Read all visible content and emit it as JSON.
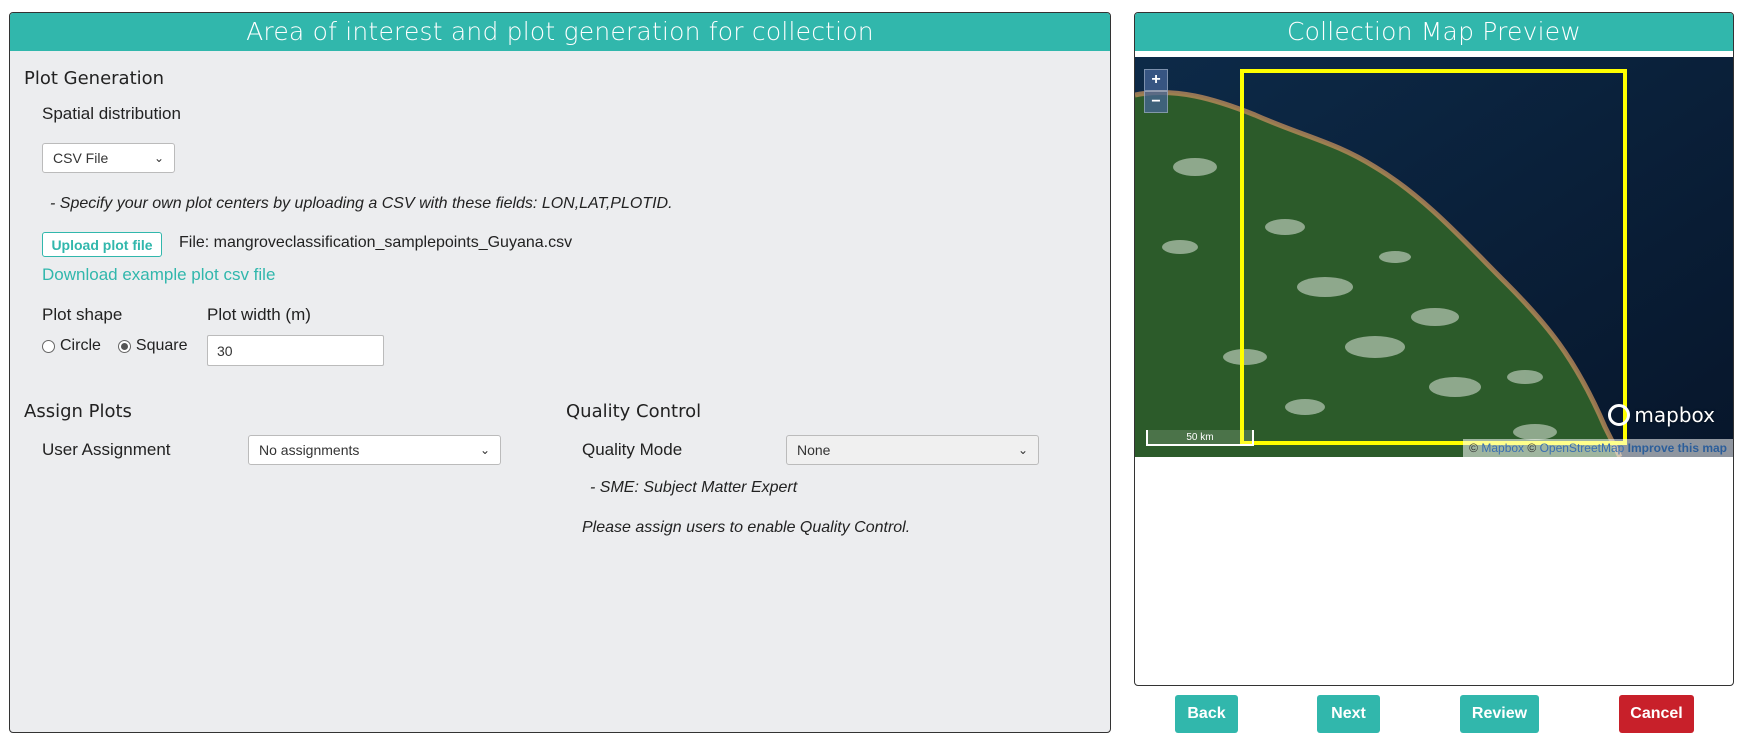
{
  "left_panel": {
    "title": "Area of interest and plot generation for collection",
    "plot_generation": {
      "heading": "Plot Generation",
      "spatial_label": "Spatial distribution",
      "spatial_value": "CSV File",
      "hint": "- Specify your own plot centers by uploading a CSV with these fields: LON,LAT,PLOTID.",
      "upload_label": "Upload plot file",
      "file_text": "File: mangroveclassification_samplepoints_Guyana.csv",
      "download_link": "Download example plot csv file",
      "shape_label": "Plot shape",
      "shape_options": [
        "Circle",
        "Square"
      ],
      "shape_selected": "Square",
      "width_label": "Plot width (m)",
      "width_value": "30"
    },
    "assign": {
      "heading": "Assign Plots",
      "user_label": "User Assignment",
      "user_value": "No assignments"
    },
    "quality": {
      "heading": "Quality Control",
      "mode_label": "Quality Mode",
      "mode_value": "None",
      "sme_note": "- SME: Subject Matter Expert",
      "enable_note": "Please assign users to enable Quality Control."
    }
  },
  "right_panel": {
    "title": "Collection Map Preview",
    "map": {
      "zoom_in": "+",
      "zoom_out": "−",
      "scale_label": "50 km",
      "logo_text": "mapbox",
      "attrib_copy1": "©",
      "attrib_mapbox": "Mapbox",
      "attrib_copy2": "©",
      "attrib_osm": "OpenStreetMap",
      "attrib_improve": "Improve this map",
      "bounds_color": "#ffff00"
    }
  },
  "nav": {
    "back": "Back",
    "next": "Next",
    "review": "Review",
    "cancel": "Cancel"
  },
  "colors": {
    "accent": "#31b7ac",
    "danger": "#c8202a",
    "panel_bg": "#ecedef"
  }
}
